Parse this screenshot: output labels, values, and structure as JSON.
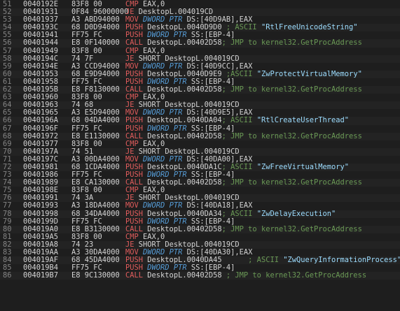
{
  "colors": {
    "background": "#1e1e1e",
    "line_number": "#858585",
    "mnemonic": "#e05c5c",
    "keyword": "#569cd6",
    "comment": "#6a9955",
    "string": "#9cdcfe",
    "text": "#d4d4d4"
  },
  "rows": [
    {
      "ln": "51",
      "addr": "0040192E",
      "hex": "83F8 00",
      "parts": [
        {
          "t": "op",
          "v": "CMP "
        },
        {
          "t": "plain",
          "v": "EAX,0"
        }
      ]
    },
    {
      "ln": "52",
      "addr": "00401931",
      "hex": "0F84 96000000",
      "parts": [
        {
          "t": "op",
          "v": "JE "
        },
        {
          "t": "plain",
          "v": "DesktopL.004019CD"
        }
      ]
    },
    {
      "ln": "53",
      "addr": "00401937",
      "hex": "A3 ABD94000",
      "parts": [
        {
          "t": "op",
          "v": "MOV "
        },
        {
          "t": "kw",
          "v": "DWORD PTR "
        },
        {
          "t": "plain",
          "v": "DS:[40D9AB],EAX"
        }
      ]
    },
    {
      "ln": "54",
      "addr": "0040193C",
      "hex": "68 D0D94000",
      "parts": [
        {
          "t": "op",
          "v": "PUSH "
        },
        {
          "t": "plain",
          "v": "DesktopL.0040D9D0 "
        },
        {
          "t": "comment",
          "v": "; ASCII "
        },
        {
          "t": "str",
          "v": "\"RtlFreeUnicodeString\""
        }
      ]
    },
    {
      "ln": "55",
      "addr": "00401941",
      "hex": "FF75 FC",
      "parts": [
        {
          "t": "op",
          "v": "PUSH "
        },
        {
          "t": "kw",
          "v": "DWORD PTR "
        },
        {
          "t": "plain",
          "v": "SS:[EBP-4]"
        }
      ]
    },
    {
      "ln": "56",
      "addr": "00401944",
      "hex": "E8 0F140000",
      "parts": [
        {
          "t": "op",
          "v": "CALL "
        },
        {
          "t": "plain",
          "v": "DesktopL.00402D58"
        },
        {
          "t": "comment",
          "v": "; JMP to kernel32.GetProcAddress"
        }
      ]
    },
    {
      "ln": "57",
      "addr": "00401949",
      "hex": "83F8 00",
      "parts": [
        {
          "t": "op",
          "v": "CMP "
        },
        {
          "t": "plain",
          "v": "EAX,0"
        }
      ]
    },
    {
      "ln": "58",
      "addr": "0040194C",
      "hex": "74 7F",
      "parts": [
        {
          "t": "op",
          "v": "JE "
        },
        {
          "t": "plain",
          "v": "SHORT DesktopL.004019CD"
        }
      ]
    },
    {
      "ln": "59",
      "addr": "0040194E",
      "hex": "A3 CCD94000",
      "parts": [
        {
          "t": "op",
          "v": "MOV "
        },
        {
          "t": "kw",
          "v": "DWORD PTR "
        },
        {
          "t": "plain",
          "v": "DS:[40D9CC],EAX"
        }
      ]
    },
    {
      "ln": "60",
      "addr": "00401953",
      "hex": "68 E9D94000",
      "parts": [
        {
          "t": "op",
          "v": "PUSH "
        },
        {
          "t": "plain",
          "v": "DesktopL.0040D9E9 "
        },
        {
          "t": "comment",
          "v": ";ASCII "
        },
        {
          "t": "str",
          "v": "\"ZwProtectVirtualMemory\""
        }
      ]
    },
    {
      "ln": "61",
      "addr": "00401958",
      "hex": "FF75 FC",
      "parts": [
        {
          "t": "op",
          "v": "PUSH "
        },
        {
          "t": "kw",
          "v": "DWORD PTR "
        },
        {
          "t": "plain",
          "v": "SS:[EBP-4]"
        }
      ]
    },
    {
      "ln": "62",
      "addr": "0040195B",
      "hex": "E8 F8130000",
      "parts": [
        {
          "t": "op",
          "v": "CALL "
        },
        {
          "t": "plain",
          "v": "DesktopL.00402D58"
        },
        {
          "t": "comment",
          "v": "; JMP to kernel32.GetProcAddress"
        }
      ]
    },
    {
      "ln": "63",
      "addr": "00401960",
      "hex": "83F8 00",
      "parts": [
        {
          "t": "op",
          "v": "CMP "
        },
        {
          "t": "plain",
          "v": "EAX,0"
        }
      ]
    },
    {
      "ln": "64",
      "addr": "00401963",
      "hex": "74 68",
      "parts": [
        {
          "t": "op",
          "v": "JE "
        },
        {
          "t": "plain",
          "v": "SHORT DesktopL.004019CD"
        }
      ]
    },
    {
      "ln": "65",
      "addr": "00401965",
      "hex": "A3 E5D94000",
      "parts": [
        {
          "t": "op",
          "v": "MOV "
        },
        {
          "t": "kw",
          "v": "DWORD PTR "
        },
        {
          "t": "plain",
          "v": "DS:[40D9E5],EAX"
        }
      ]
    },
    {
      "ln": "66",
      "addr": "0040196A",
      "hex": "68 04DA4000",
      "parts": [
        {
          "t": "op",
          "v": "PUSH "
        },
        {
          "t": "plain",
          "v": "DesktopL.0040DA04"
        },
        {
          "t": "comment",
          "v": "; ASCII "
        },
        {
          "t": "str",
          "v": "\"RtlCreateUserThread\""
        }
      ]
    },
    {
      "ln": "67",
      "addr": "0040196F",
      "hex": "FF75 FC",
      "parts": [
        {
          "t": "op",
          "v": "PUSH "
        },
        {
          "t": "kw",
          "v": "DWORD PTR "
        },
        {
          "t": "plain",
          "v": "SS:[EBP-4]"
        }
      ]
    },
    {
      "ln": "68",
      "addr": "00401972",
      "hex": "E8 E1130000",
      "parts": [
        {
          "t": "op",
          "v": "CALL "
        },
        {
          "t": "plain",
          "v": "DesktopL.00402D58"
        },
        {
          "t": "comment",
          "v": "; JMP to kernel32.GetProcAddress"
        }
      ]
    },
    {
      "ln": "69",
      "addr": "00401977",
      "hex": "83F8 00",
      "parts": [
        {
          "t": "op",
          "v": "CMP "
        },
        {
          "t": "plain",
          "v": "EAX,0"
        }
      ]
    },
    {
      "ln": "70",
      "addr": "0040197A",
      "hex": "74 51",
      "parts": [
        {
          "t": "op",
          "v": "JE "
        },
        {
          "t": "plain",
          "v": "SHORT DesktopL.004019CD"
        }
      ]
    },
    {
      "ln": "71",
      "addr": "0040197C",
      "hex": "A3 00DA4000",
      "parts": [
        {
          "t": "op",
          "v": "MOV "
        },
        {
          "t": "kw",
          "v": "DWORD PTR "
        },
        {
          "t": "plain",
          "v": "DS:[40DA00],EAX"
        }
      ]
    },
    {
      "ln": "72",
      "addr": "00401981",
      "hex": "68 1CDA4000",
      "parts": [
        {
          "t": "op",
          "v": "PUSH "
        },
        {
          "t": "plain",
          "v": "DesktopL.0040DA1C"
        },
        {
          "t": "comment",
          "v": "; ASCII "
        },
        {
          "t": "str",
          "v": "\"ZwFreeVirtualMemory\""
        }
      ]
    },
    {
      "ln": "73",
      "addr": "00401986",
      "hex": "FF75 FC",
      "parts": [
        {
          "t": "op",
          "v": "PUSH "
        },
        {
          "t": "kw",
          "v": "DWORD PTR "
        },
        {
          "t": "plain",
          "v": "SS:[EBP-4]"
        }
      ]
    },
    {
      "ln": "74",
      "addr": "00401989",
      "hex": "E8 CA130000",
      "parts": [
        {
          "t": "op",
          "v": "CALL "
        },
        {
          "t": "plain",
          "v": "DesktopL.00402D58"
        },
        {
          "t": "comment",
          "v": "; JMP to kernel32.GetProcAddress"
        }
      ]
    },
    {
      "ln": "75",
      "addr": "0040198E",
      "hex": "83F8 00",
      "parts": [
        {
          "t": "op",
          "v": "CMP "
        },
        {
          "t": "plain",
          "v": "EAX,0"
        }
      ]
    },
    {
      "ln": "76",
      "addr": "00401991",
      "hex": "74 3A",
      "parts": [
        {
          "t": "op",
          "v": "JE "
        },
        {
          "t": "plain",
          "v": "SHORT DesktopL.004019CD"
        }
      ]
    },
    {
      "ln": "77",
      "addr": "00401993",
      "hex": "A3 18DA4000",
      "parts": [
        {
          "t": "op",
          "v": "MOV "
        },
        {
          "t": "kw",
          "v": "DWORD PTR "
        },
        {
          "t": "plain",
          "v": "DS:[40DA18],EAX"
        }
      ]
    },
    {
      "ln": "78",
      "addr": "00401998",
      "hex": "68 34DA4000",
      "parts": [
        {
          "t": "op",
          "v": "PUSH "
        },
        {
          "t": "plain",
          "v": "DesktopL.0040DA34"
        },
        {
          "t": "comment",
          "v": "; ASCII "
        },
        {
          "t": "str",
          "v": "\"ZwDelayExecution\""
        }
      ]
    },
    {
      "ln": "79",
      "addr": "0040199D",
      "hex": "FF75 FC",
      "parts": [
        {
          "t": "op",
          "v": "PUSH "
        },
        {
          "t": "kw",
          "v": "DWORD PTR "
        },
        {
          "t": "plain",
          "v": "SS:[EBP-4]"
        }
      ]
    },
    {
      "ln": "80",
      "addr": "004019A0",
      "hex": "E8 B3130000",
      "parts": [
        {
          "t": "op",
          "v": "CALL "
        },
        {
          "t": "plain",
          "v": "DesktopL.00402D58"
        },
        {
          "t": "comment",
          "v": "; JMP to kernel32.GetProcAddress"
        }
      ]
    },
    {
      "ln": "81",
      "addr": "004019A5",
      "hex": "83F8 00",
      "parts": [
        {
          "t": "op",
          "v": "CMP "
        },
        {
          "t": "plain",
          "v": "EAX,0"
        }
      ]
    },
    {
      "ln": "82",
      "addr": "004019A8",
      "hex": "74 23",
      "parts": [
        {
          "t": "op",
          "v": "JE "
        },
        {
          "t": "plain",
          "v": "SHORT DesktopL.004019CD"
        }
      ]
    },
    {
      "ln": "83",
      "addr": "004019AA",
      "hex": "A3 30DA4000",
      "parts": [
        {
          "t": "op",
          "v": "MOV "
        },
        {
          "t": "kw",
          "v": "DWORD PTR "
        },
        {
          "t": "plain",
          "v": "DS:[40DA30],EAX"
        }
      ]
    },
    {
      "ln": "84",
      "addr": "004019AF",
      "hex": "68 45DA4000",
      "parts": [
        {
          "t": "op",
          "v": "PUSH "
        },
        {
          "t": "plain",
          "v": "DesktopL.0040DA45      "
        },
        {
          "t": "comment",
          "v": "; ASCII "
        },
        {
          "t": "str",
          "v": "\"ZwQueryInformationProcess\""
        }
      ]
    },
    {
      "ln": "85",
      "addr": "004019B4",
      "hex": "FF75 FC",
      "parts": [
        {
          "t": "op",
          "v": "PUSH "
        },
        {
          "t": "kw",
          "v": "DWORD PTR "
        },
        {
          "t": "plain",
          "v": "SS:[EBP-4]"
        }
      ]
    },
    {
      "ln": "86",
      "addr": "004019B7",
      "hex": "E8 9C130000",
      "parts": [
        {
          "t": "op",
          "v": "CALL "
        },
        {
          "t": "plain",
          "v": "DesktopL.00402D58 "
        },
        {
          "t": "comment",
          "v": "; JMP to kernel32.GetProcAddress"
        }
      ]
    }
  ]
}
